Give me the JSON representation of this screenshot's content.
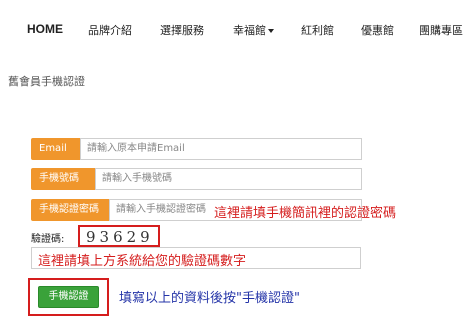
{
  "nav": {
    "items": [
      "HOME",
      "品牌介紹",
      "選擇服務",
      "幸福館",
      "紅利館",
      "優惠館",
      "團購專區"
    ]
  },
  "page_title": "舊會員手機認證",
  "form": {
    "email_label": "Email",
    "email_placeholder": "請輸入原本申請Email",
    "phone_label": "手機號碼",
    "phone_placeholder": "請輸入手機號碼",
    "code_label": "手機認證密碼",
    "code_placeholder": "請輸入手機認證密碼",
    "captcha_label": "驗證碼:",
    "captcha_value": "93629",
    "submit_label": "手機認證"
  },
  "annotations": {
    "sms_note": "這裡請填手機簡訊裡的認證密碼",
    "captcha_note": "這裡請填上方系統給您的驗證碼數字",
    "submit_note": "填寫以上的資料後按\"手機認證\""
  },
  "colors": {
    "label_orange": "#f0962c",
    "button_green": "#3aa23a",
    "annotation_red": "#d51d1d",
    "annotation_blue": "#2434a8"
  }
}
